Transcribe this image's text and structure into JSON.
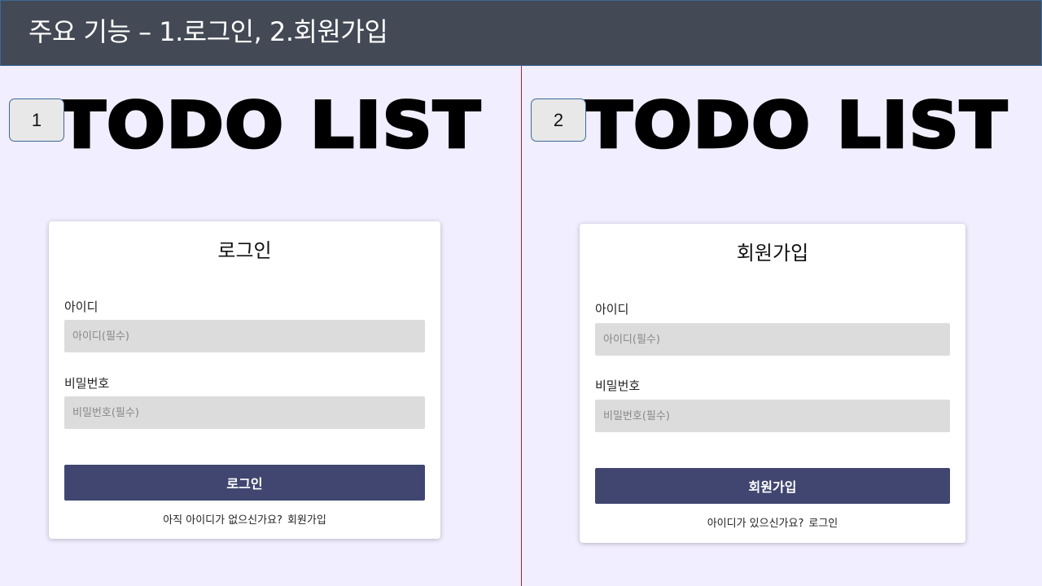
{
  "header": {
    "title": "주요 기능 – 1.로그인, 2.회원가입"
  },
  "colors": {
    "header_bg": "#434a55",
    "page_bg": "#f1eeff",
    "divider": "#b0203a",
    "button_bg": "#404670",
    "input_bg": "#dcdcdc"
  },
  "login_panel": {
    "badge": "1",
    "logo": "TODO LIST",
    "title": "로그인",
    "id_label": "아이디",
    "id_placeholder": "아이디(필수)",
    "pw_label": "비밀번호",
    "pw_placeholder": "비밀번호(필수)",
    "submit_label": "로그인",
    "switch_text": "아직 아이디가 없으신가요?",
    "switch_link": "회원가입"
  },
  "signup_panel": {
    "badge": "2",
    "logo": "TODO LIST",
    "title": "회원가입",
    "id_label": "아이디",
    "id_placeholder": "아이디(필수)",
    "pw_label": "비밀번호",
    "pw_placeholder": "비밀번호(필수)",
    "submit_label": "회원가입",
    "switch_text": "아이디가 있으신가요?",
    "switch_link": "로그인"
  }
}
